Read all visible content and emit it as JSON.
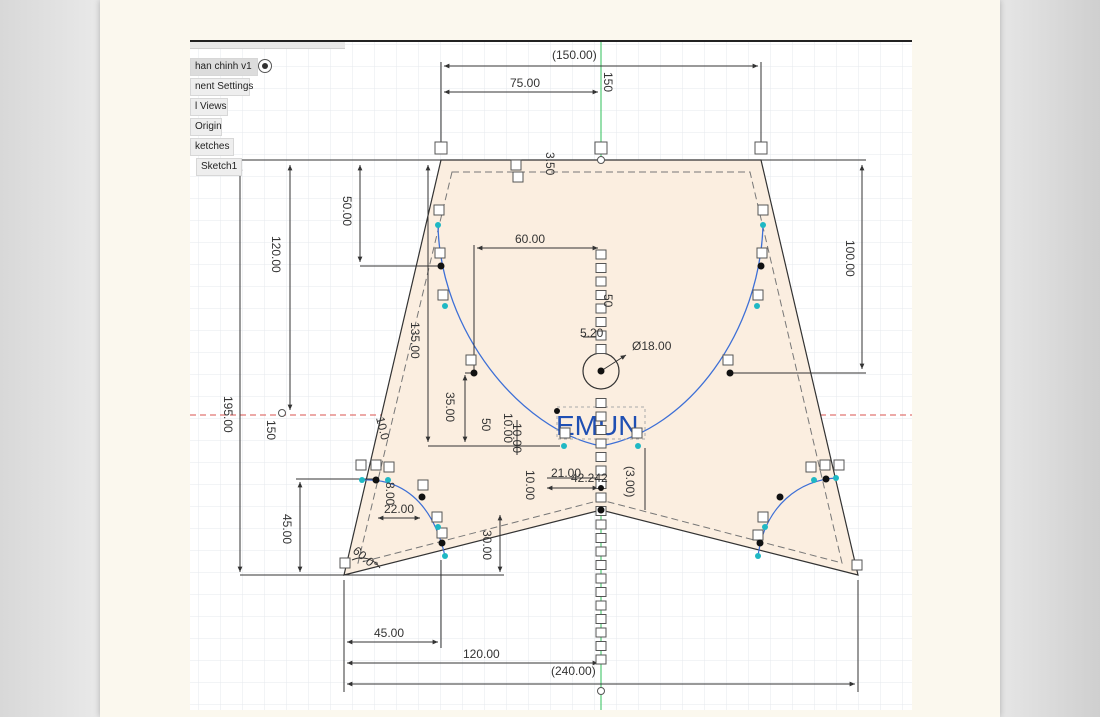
{
  "browser": {
    "component_name": "han chinh v1",
    "items": [
      {
        "label": "nent Settings"
      },
      {
        "label": "l Views"
      },
      {
        "label": "Origin"
      },
      {
        "label": "ketches"
      },
      {
        "label": "Sketch1"
      }
    ]
  },
  "dimensions": {
    "top_width": "(150.00)",
    "half_top": "75.00",
    "center_top": "150",
    "small_offset": "3.50",
    "left_upper": "50.00",
    "left_height_120": "120.00",
    "right_height_100": "100.00",
    "curve_width": "60.00",
    "depth_135": "135.00",
    "total_height": "195.00",
    "small_520": "5.20",
    "circle_dia": "Ø18.00",
    "left_35": "35.00",
    "center_50_top": "50",
    "center_50_mid": "50",
    "center_150_left": "150",
    "ten_a": "10.00",
    "ten_b": "10.00",
    "ten_c": "10.00",
    "small_2100": "21.00",
    "small_242": "42.242",
    "dim_300": "(3.00)",
    "small_80": "8.00",
    "left_22": "22.00",
    "left_45v": "45.00",
    "small_30": "30.00",
    "angle_label": "60.0°",
    "bottom_45": "45.00",
    "bottom_120": "120.00",
    "bottom_total": "(240.00)",
    "slanted_10": "10.0"
  },
  "brand": {
    "text": "EMUN"
  },
  "colors": {
    "fill": "#fbeee0",
    "curve": "#3d6fd6",
    "constraint_dot": "#1fb8c4",
    "center_axis": "#2fbf5a",
    "horizontal_axis": "#d9534f"
  }
}
